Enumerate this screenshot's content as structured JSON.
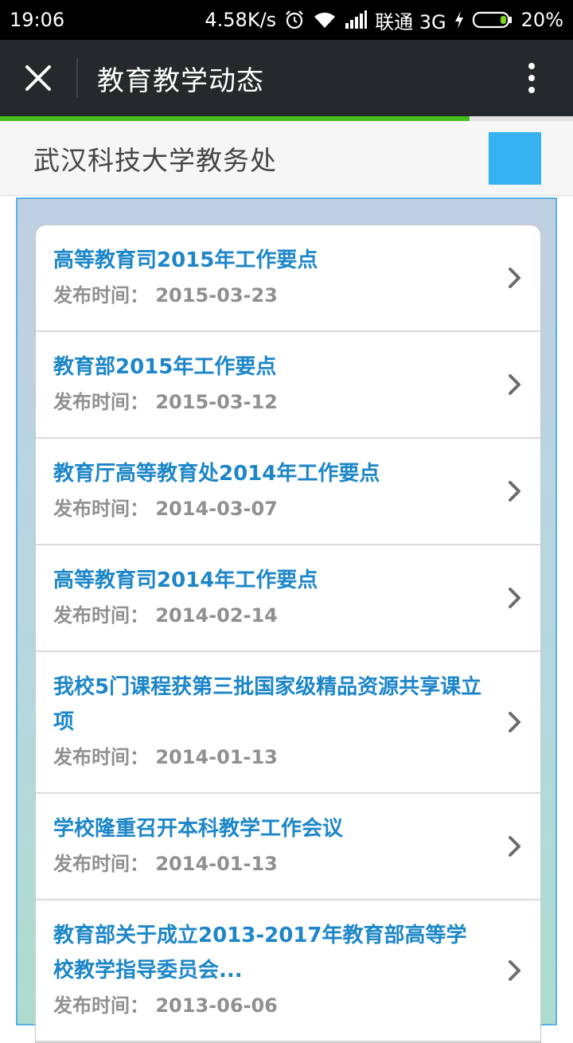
{
  "status_bar": {
    "time": "19:06",
    "net_speed": "4.58K/s",
    "carrier": "联通 3G",
    "battery": "20%",
    "icons": [
      "alarm-icon",
      "wifi-icon",
      "signal-icon",
      "charging-icon",
      "battery-icon"
    ]
  },
  "app_bar": {
    "title": "教育教学动态",
    "close_icon": "close-icon",
    "more_icon": "more-vertical-icon"
  },
  "page_load_progress": 0.82,
  "site": {
    "name": "武汉科技大学教务处",
    "accent": "#35b2ef"
  },
  "colors": {
    "title": "#1c86c8",
    "progress": "#45c01a",
    "appbar": "#25292b"
  },
  "news": [
    {
      "title": "高等教育司2015年工作要点",
      "date_label": "发布时间：",
      "date": "2015-03-23"
    },
    {
      "title": "教育部2015年工作要点",
      "date_label": "发布时间：",
      "date": "2015-03-12"
    },
    {
      "title": "教育厅高等教育处2014年工作要点",
      "date_label": "发布时间：",
      "date": "2014-03-07"
    },
    {
      "title": "高等教育司2014年工作要点",
      "date_label": "发布时间：",
      "date": "2014-02-14"
    },
    {
      "title": "我校5门课程获第三批国家级精品资源共享课立项",
      "date_label": "发布时间：",
      "date": "2014-01-13"
    },
    {
      "title": "学校隆重召开本科教学工作会议",
      "date_label": "发布时间：",
      "date": "2014-01-13"
    },
    {
      "title": "教育部关于成立2013-2017年教育部高等学校教学指导委员会...",
      "date_label": "发布时间：",
      "date": "2013-06-06"
    }
  ]
}
